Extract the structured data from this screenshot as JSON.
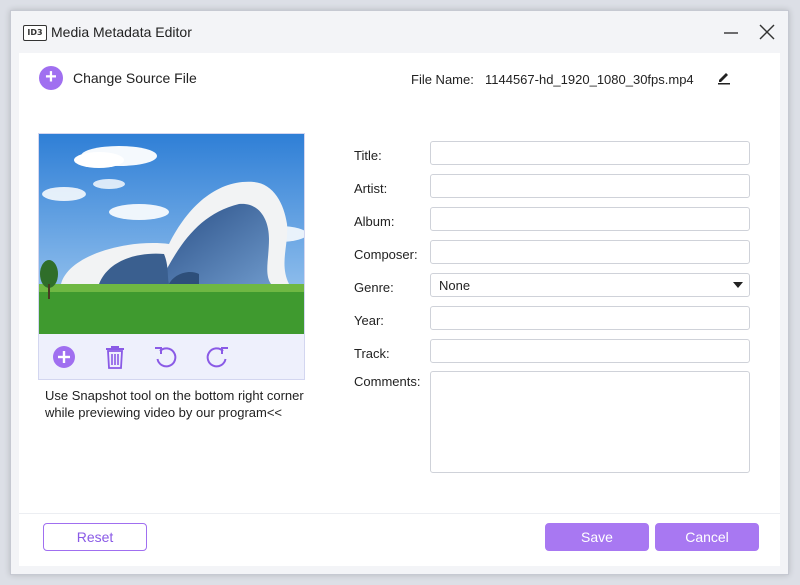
{
  "window": {
    "app_badge": "ID3",
    "title": "Media Metadata Editor"
  },
  "toolbar": {
    "change_source_label": "Change Source File",
    "file_name_label": "File Name:",
    "file_name_value": "1144567-hd_1920_1080_30fps.mp4"
  },
  "cover": {
    "hint": "Use Snapshot tool on the bottom right corner while previewing video by our program<<"
  },
  "fields": {
    "title": {
      "label": "Title:",
      "value": ""
    },
    "artist": {
      "label": "Artist:",
      "value": ""
    },
    "album": {
      "label": "Album:",
      "value": ""
    },
    "composer": {
      "label": "Composer:",
      "value": ""
    },
    "genre": {
      "label": "Genre:",
      "value": "None"
    },
    "year": {
      "label": "Year:",
      "value": ""
    },
    "track": {
      "label": "Track:",
      "value": ""
    },
    "comments": {
      "label": "Comments:",
      "value": ""
    }
  },
  "footer": {
    "reset_label": "Reset",
    "save_label": "Save",
    "cancel_label": "Cancel"
  },
  "colors": {
    "accent": "#a878f2",
    "accent_border": "#a06ff0",
    "window_bg": "#f3f4f7",
    "panel_bg": "#ffffff"
  },
  "icons": {
    "app": "id3-badge-icon",
    "minimize": "minimize-icon",
    "close": "close-icon",
    "change_source": "plus-circle-icon",
    "edit": "pencil-icon",
    "add_cover": "plus-circle-icon",
    "delete_cover": "trash-icon",
    "rotate_left": "rotate-left-icon",
    "rotate_right": "rotate-right-icon",
    "genre_dropdown": "caret-down-icon"
  }
}
